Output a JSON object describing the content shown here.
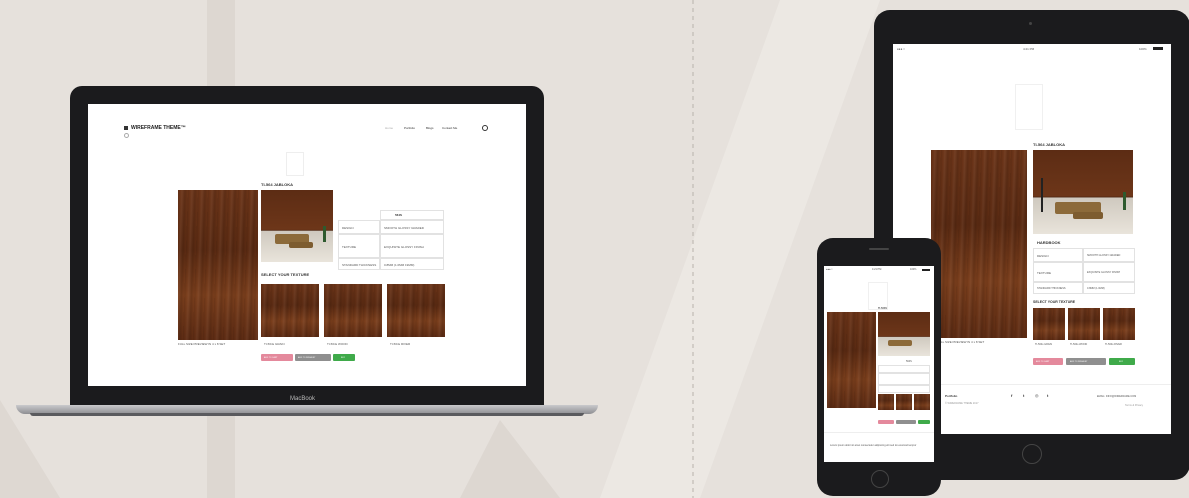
{
  "laptop": {
    "brand_label": "MacBook",
    "logo_text": "WIREFRAME THEME™",
    "nav": [
      "Home",
      "Portfolio",
      "Blogs",
      "Contact Me"
    ],
    "product_title": "TI-564 JABLOKA",
    "caption": "FULL SIZE PREVIEW IN 4 x 8 SET",
    "spec_header": "564S",
    "specs": [
      {
        "label": "DESIGN",
        "value": "SMOOTH GLOSSY GRADED"
      },
      {
        "label": "TEXTURE",
        "value": "EXQUISITE GLOSSY FINISH"
      },
      {
        "label": "STANDARD THICKNESS",
        "value": "0.8MM (1.0MM 19MM)"
      }
    ],
    "texture_title": "SELECT YOUR TEXTURE",
    "textures": [
      "TI-564s GRAIN",
      "TI-564s WOOD",
      "TI-564s RIVER"
    ],
    "buttons": [
      "ADD TO CART",
      "ADD TO WISHLIST",
      "BUY"
    ]
  },
  "tablet": {
    "status_left": "●●● ▿",
    "status_time": "4:21 PM",
    "status_right": "100%",
    "product_title": "TI-564 JABLOKA",
    "caption": "FULL SIZE PREVIEW IN 4 x 8 SET",
    "spec_header": "HARDBOOK",
    "specs": [
      {
        "label": "DESIGN",
        "value": "SMOOTH GLOSSY GRADED"
      },
      {
        "label": "TEXTURE",
        "value": "EXQUISITE GLOSSY FINISH"
      },
      {
        "label": "STANDARD THICKNESS",
        "value": "0.8MM (1.0MM)"
      }
    ],
    "texture_title": "SELECT YOUR TEXTURE",
    "textures": [
      "TI-564s GRAIN",
      "TI-564s WOOD",
      "TI-564s RIVER"
    ],
    "buttons": [
      "ADD TO CART",
      "ADD TO WISHLIST",
      "BUY"
    ],
    "footer_left": "Portfolio",
    "footer_left_small": "© WIREFRAME THEME 2017",
    "footer_social": [
      "f",
      "t",
      "◎",
      "t"
    ],
    "footer_right": "EMAIL: INFO@WIREFRAME.COM",
    "footer_right_small": "Terms & Privacy"
  },
  "phone": {
    "status_left": "●●● ▿",
    "status_time": "4:21 PM",
    "status_right": "100%",
    "product_title": "TI-564S",
    "spec_header": "564S",
    "bottom_text": "Lorem ipsum dolor sit amet consectetur adipiscing elit sed do eiusmod tempor"
  },
  "colors": {
    "background": "#e6e1dc",
    "device_dark": "#1c1c1e",
    "btn_pink": "#e4899c",
    "btn_grey": "#8f8f8f",
    "btn_green": "#3faa4a"
  }
}
